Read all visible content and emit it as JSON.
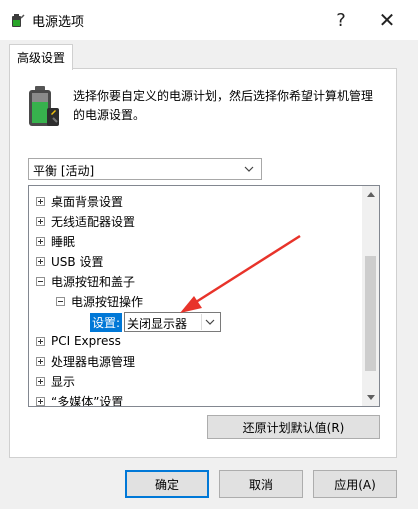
{
  "window": {
    "title": "电源选项",
    "help_label": "?",
    "close_label": "✕"
  },
  "tab": {
    "label": "高级设置"
  },
  "description": "选择你要自定义的电源计划，然后选择你希望计算机管理的电源设置。",
  "plan_select": {
    "value": "平衡 [活动]"
  },
  "tree": {
    "items": [
      {
        "label": "桌面背景设置",
        "state": "collapsed"
      },
      {
        "label": "无线适配器设置",
        "state": "collapsed"
      },
      {
        "label": "睡眠",
        "state": "collapsed"
      },
      {
        "label": "USB 设置",
        "state": "collapsed"
      },
      {
        "label": "电源按钮和盖子",
        "state": "expanded"
      },
      {
        "label": "电源按钮操作",
        "state": "expanded"
      },
      {
        "label": "PCI Express",
        "state": "collapsed"
      },
      {
        "label": "处理器电源管理",
        "state": "collapsed"
      },
      {
        "label": "显示",
        "state": "collapsed"
      },
      {
        "label": "“多媒体”设置",
        "state": "collapsed"
      }
    ],
    "setting_label": "设置:",
    "setting_value": "关闭显示器"
  },
  "buttons": {
    "restore": "还原计划默认值(R)",
    "ok": "确定",
    "cancel": "取消",
    "apply": "应用(A)"
  },
  "colors": {
    "accent": "#0078d7",
    "annotation_arrow": "#e8332a"
  }
}
